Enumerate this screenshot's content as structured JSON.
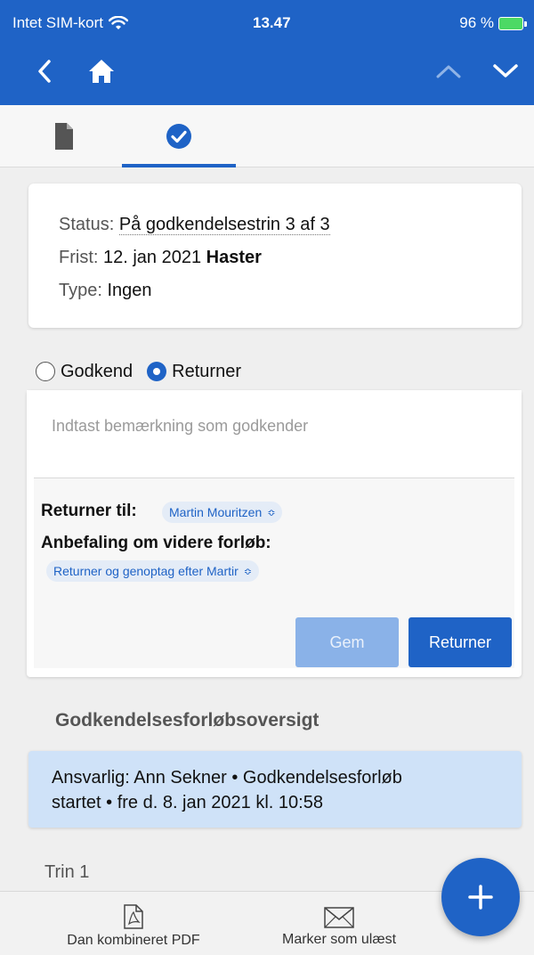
{
  "status_bar": {
    "carrier": "Intet SIM-kort",
    "time": "13.47",
    "battery": "96 %"
  },
  "tabs": [
    {
      "name": "document",
      "icon": "document-icon",
      "active": false
    },
    {
      "name": "approval",
      "icon": "check-circle-icon",
      "active": true
    }
  ],
  "info": {
    "status_label": "Status:",
    "status_value": "På godkendelsestrin 3 af 3",
    "deadline_label": "Frist:",
    "deadline_value": "12. jan 2021",
    "deadline_flag": "Haster",
    "type_label": "Type:",
    "type_value": "Ingen"
  },
  "decision": {
    "approve_label": "Godkend",
    "return_label": "Returner",
    "selected": "Returner"
  },
  "form": {
    "comment_placeholder": "Indtast bemærkning som godkender",
    "return_to_label": "Returner til:",
    "return_to_value": "Martin Mouritzen",
    "recommendation_label": "Anbefaling om videre forløb:",
    "recommendation_value": "Returner og genoptag efter Martir",
    "save_label": "Gem",
    "return_button_label": "Returner"
  },
  "overview": {
    "title": "Godkendelsesforløbsoversigt",
    "entry_line1": "Ansvarlig: Ann Sekner • Godkendelsesforløb",
    "entry_line2": "startet •  fre d. 8. jan 2021 kl. 10:58",
    "step_label": "Trin 1"
  },
  "bottom_bar": {
    "pdf_label": "Dan kombineret PDF",
    "unread_label": "Marker som ulæst"
  },
  "colors": {
    "primary": "#1f63c6",
    "history_bg": "#cfe2f8",
    "disabled_button": "#8ab2e8"
  }
}
